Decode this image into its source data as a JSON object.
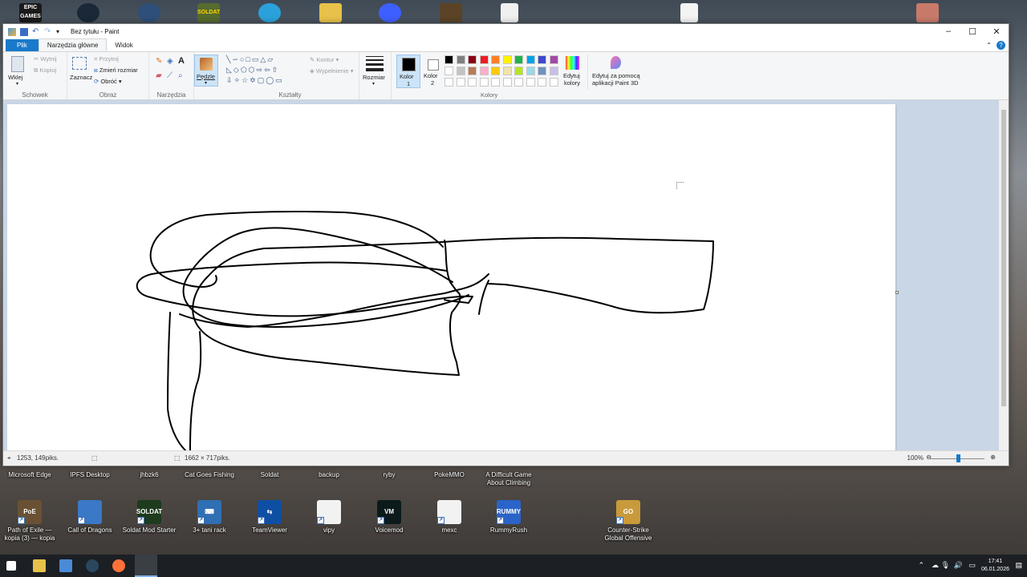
{
  "window": {
    "title": "Bez tytułu - Paint",
    "controls": {
      "minimize": "–",
      "maximize": "☐",
      "close": "✕"
    }
  },
  "ribbon": {
    "tabs": {
      "file": "Plik",
      "home": "Narzędzia główne",
      "view": "Widok"
    },
    "clipboard": {
      "paste": "Wklej",
      "cut": "Wytnij",
      "copy": "Kopiuj",
      "label": "Schowek"
    },
    "image": {
      "select": "Zaznacz",
      "crop": "Przytnij",
      "resize": "Zmień rozmiar",
      "rotate": "Obróć",
      "label": "Obraz"
    },
    "tools": {
      "label": "Narzędzia",
      "brushes": "Pędzle"
    },
    "shapes": {
      "outline": "Kontur",
      "fill": "Wypełnienie",
      "label": "Kształty"
    },
    "size": "Rozmiar",
    "color1": {
      "line1": "Kolor",
      "line2": "1"
    },
    "color2": {
      "line1": "Kolor",
      "line2": "2"
    },
    "colors_label": "Kolory",
    "edit_colors": {
      "line1": "Edytuj",
      "line2": "kolory"
    },
    "paint3d": {
      "line1": "Edytuj za pomocą",
      "line2": "aplikacji Paint 3D"
    },
    "palette_row1": [
      "#000000",
      "#7f7f7f",
      "#880015",
      "#ed1c24",
      "#ff7f27",
      "#fff200",
      "#22b14c",
      "#00a2e8",
      "#3f48cc",
      "#a349a4"
    ],
    "palette_row2": [
      "#ffffff",
      "#c3c3c3",
      "#b97a57",
      "#ffaec9",
      "#ffc90e",
      "#efe4b0",
      "#b5e61d",
      "#99d9ea",
      "#7092be",
      "#c8bfe7"
    ]
  },
  "status": {
    "cursor_pos": "1253, 149piks.",
    "image_size": "1662 × 717piks.",
    "zoom": "100%"
  },
  "desktop": {
    "row1": [
      {
        "label": "Microsoft Edge",
        "color": "#1f6fc8"
      },
      {
        "label": "IPFS Desktop",
        "color": "#2a8a8e"
      },
      {
        "label": "jhbzk6",
        "color": "#7a6a55"
      },
      {
        "label": "Cat Goes Fishing",
        "color": "#4d8fbf"
      },
      {
        "label": "Soldat",
        "color": "#6b7a3a"
      },
      {
        "label": "backup",
        "color": "#d9b44a"
      },
      {
        "label": "ryby",
        "color": "#e8e8e8"
      },
      {
        "label": "PokeMMO",
        "color": "#c23b3b"
      },
      {
        "label": "A Difficult Game About Climbing",
        "color": "#5b7aa5"
      }
    ],
    "row2": [
      {
        "label": "Path of Exile — kopia (3) — kopia",
        "color": "#6a5134",
        "glyph": "PoE"
      },
      {
        "label": "Call of Dragons",
        "color": "#3b78c5",
        "glyph": ""
      },
      {
        "label": "Soldat Mod Starter",
        "color": "#1d3b1d",
        "glyph": "SOLDAT"
      },
      {
        "label": "3+ tani rack",
        "color": "#2f6fb3",
        "glyph": "⌨"
      },
      {
        "label": "TeamViewer",
        "color": "#0e4ea3",
        "glyph": "⇆"
      },
      {
        "label": "vipy",
        "color": "#f2f2f2",
        "glyph": ""
      },
      {
        "label": "Voicemod",
        "color": "#0c1a1c",
        "glyph": "VM"
      },
      {
        "label": "mexc",
        "color": "#f2f2f2",
        "glyph": ""
      },
      {
        "label": "RummyRush",
        "color": "#2a64c9",
        "glyph": "RUMMY"
      },
      {
        "label": "Counter-Strike Global Offensive",
        "color": "#c99a3c",
        "glyph": "GO"
      }
    ]
  },
  "taskbar": {
    "time": "17:41",
    "date": "06.01.2026"
  }
}
